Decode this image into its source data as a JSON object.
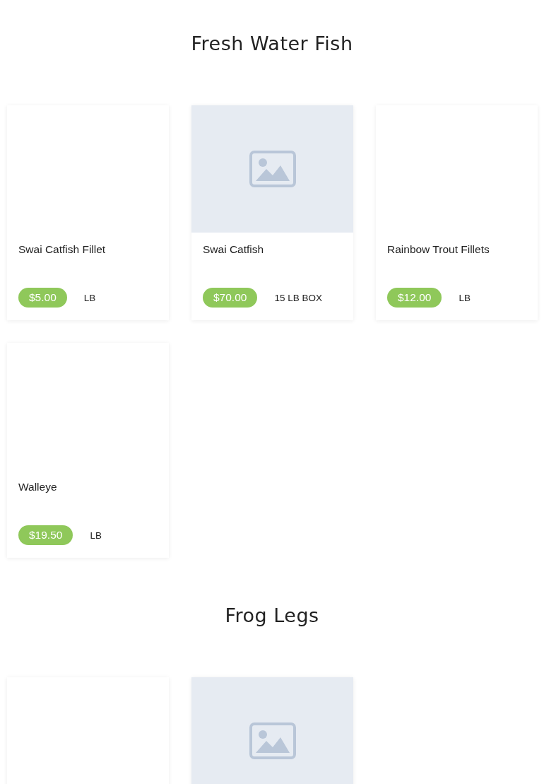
{
  "sections": [
    {
      "title": "Fresh Water Fish",
      "products": [
        {
          "kind": "blank",
          "name": "Swai Catfish Fillet",
          "price": "$5.00",
          "unit": "LB"
        },
        {
          "kind": "placeholder",
          "name": "Swai Catfish",
          "price": "$70.00",
          "unit": "15 LB BOX"
        },
        {
          "kind": "blank",
          "name": "Rainbow Trout Fillets",
          "price": "$12.00",
          "unit": "LB"
        },
        {
          "kind": "blank",
          "name": "Walleye",
          "price": "$19.50",
          "unit": "LB"
        }
      ]
    },
    {
      "title": "Frog Legs",
      "products": [
        {
          "kind": "blank"
        },
        {
          "kind": "placeholder"
        }
      ]
    }
  ]
}
